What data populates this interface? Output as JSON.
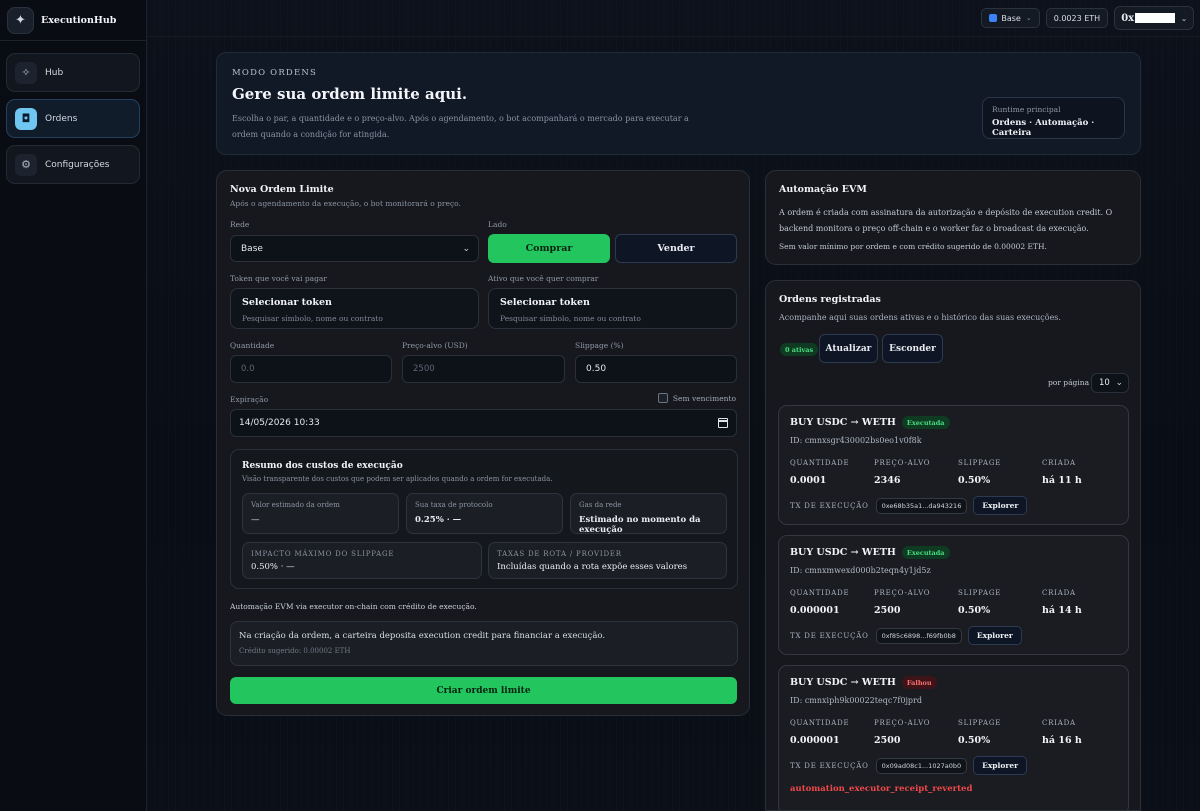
{
  "brand": {
    "name": "ExecutionHub"
  },
  "nav": [
    {
      "label": "Hub",
      "icon": "sparkle-icon"
    },
    {
      "label": "Ordens",
      "icon": "robot-icon",
      "active": true
    },
    {
      "label": "Configurações",
      "icon": "gear-icon"
    }
  ],
  "topbar": {
    "network": "Base",
    "balance": "0.0023 ETH",
    "wallet_prefix": "0x"
  },
  "hero": {
    "eyebrow": "MODO ORDENS",
    "title": "Gere sua ordem limite aqui.",
    "description": "Escolha o par, a quantidade e o preço-alvo. Após o agendamento, o bot acompanhará o mercado para executar a ordem quando a condição for atingida.",
    "runtime_label": "Runtime principal",
    "runtime_value": "Ordens · Automação · Carteira"
  },
  "form": {
    "title": "Nova Ordem Limite",
    "subtitle": "Após o agendamento da execução, o bot monitorará o preço.",
    "rede_label": "Rede",
    "rede_value": "Base",
    "lado_label": "Lado",
    "buy_label": "Comprar",
    "sell_label": "Vender",
    "pay_label": "Token que você vai pagar",
    "buy_token_label": "Ativo que você quer comprar",
    "select_token": "Selecionar token",
    "select_token_hint": "Pesquisar símbolo, nome ou contrato",
    "qty_label": "Quantidade",
    "qty_placeholder": "0.0",
    "price_label": "Preço-alvo (USD)",
    "price_placeholder": "2500",
    "slip_label": "Slippage (%)",
    "slip_value": "0.50",
    "exp_label": "Expiração",
    "no_expiry": "Sem vencimento",
    "exp_value": "14/05/2026 10:33",
    "summary": {
      "title": "Resumo dos custos de execução",
      "subtitle": "Visão transparente dos custos que podem ser aplicados quando a ordem for executada.",
      "est_label": "Valor estimado da ordem",
      "est_value": "—",
      "fee_label": "Sua taxa de protocolo",
      "fee_value": "0.25% · —",
      "gas_label": "Gas da rede",
      "gas_value": "Estimado no momento da execução",
      "impact_label": "IMPACTO MÁXIMO DO SLIPPAGE",
      "impact_value": "0.50% · —",
      "route_label": "TAXAS DE ROTA / PROVIDER",
      "route_value": "Incluídas quando a rota expõe esses valores"
    },
    "auto_note": "Automação EVM via executor on-chain com crédito de execução.",
    "credit_text": "Na criação da ordem, a carteira deposita execution credit para financiar a execução.",
    "credit_hint": "Crédito sugerido: 0.00002 ETH",
    "submit": "Criar ordem limite"
  },
  "evm": {
    "title": "Automação EVM",
    "body": "A ordem é criada com assinatura da autorização e depósito de execution credit. O backend monitora o preço off-chain e o worker faz o broadcast da execução.",
    "small": "Sem valor mínimo por ordem e com crédito sugerido de 0.00002 ETH."
  },
  "orders": {
    "title": "Ordens registradas",
    "subtitle": "Acompanhe aqui suas ordens ativas e o histórico das suas execuções.",
    "active_badge": "0 ativas",
    "refresh": "Atualizar",
    "hide": "Esconder",
    "per_page_label": "por página",
    "per_page": "10",
    "col_qty": "QUANTIDADE",
    "col_price": "PREÇO-ALVO",
    "col_slip": "SLIPPAGE",
    "col_created": "CRIADA",
    "col_tx": "TX DE EXECUÇÃO",
    "explorer": "Explorer",
    "items": [
      {
        "pair": "BUY USDC → WETH",
        "status": "Executada",
        "id": "ID: cmnxsgr430002bs0eo1v0f8k",
        "qty": "0.0001",
        "price": "2346",
        "slip": "0.50%",
        "created": "há 11 h",
        "tx": "0xe68b35a1...da943216"
      },
      {
        "pair": "BUY USDC → WETH",
        "status": "Executada",
        "id": "ID: cmnxmwexd000b2teqn4y1jd5z",
        "qty": "0.000001",
        "price": "2500",
        "slip": "0.50%",
        "created": "há 14 h",
        "tx": "0xf85c6898...f69fb0b8"
      },
      {
        "pair": "BUY USDC → WETH",
        "status": "Falhou",
        "id": "ID: cmnxiph9k00022teqc7f0jprd",
        "qty": "0.000001",
        "price": "2500",
        "slip": "0.50%",
        "created": "há 16 h",
        "tx": "0x09ad08c1...1027a0b0",
        "error": "automation_executor_receipt_reverted"
      }
    ]
  },
  "colors": {
    "accent_green": "#22c55e",
    "active_nav": "#6ec6f1",
    "error": "#f04848"
  }
}
